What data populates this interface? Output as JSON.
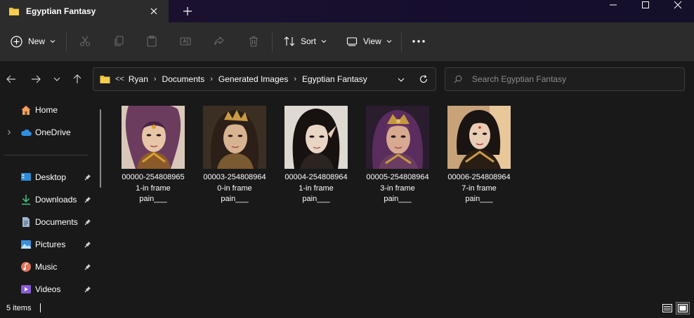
{
  "window": {
    "tab_title": "Egyptian Fantasy"
  },
  "toolbar": {
    "new_label": "New",
    "sort_label": "Sort",
    "view_label": "View"
  },
  "address": {
    "overflow": "<<",
    "crumbs": [
      "Ryan",
      "Documents",
      "Generated Images",
      "Egyptian Fantasy"
    ]
  },
  "search": {
    "placeholder": "Search Egyptian Fantasy"
  },
  "sidebar": {
    "items": [
      {
        "label": "Home"
      },
      {
        "label": "OneDrive"
      },
      {
        "label": "Desktop"
      },
      {
        "label": "Downloads"
      },
      {
        "label": "Documents"
      },
      {
        "label": "Pictures"
      },
      {
        "label": "Music"
      },
      {
        "label": "Videos"
      }
    ]
  },
  "files": [
    {
      "line1": "00000-254808965",
      "line2": "1-in frame",
      "line3": "pain___"
    },
    {
      "line1": "00003-254808964",
      "line2": "0-in frame",
      "line3": "pain___"
    },
    {
      "line1": "00004-254808964",
      "line2": "1-in frame",
      "line3": "pain___"
    },
    {
      "line1": "00005-254808964",
      "line2": "3-in frame",
      "line3": "pain___"
    },
    {
      "line1": "00006-254808964",
      "line2": "7-in frame",
      "line3": "pain___"
    }
  ],
  "status": {
    "item_count": "5 items"
  },
  "colors": {
    "accent_blue": "#4cc2ff",
    "folder_yellow": "#f2c94c"
  }
}
